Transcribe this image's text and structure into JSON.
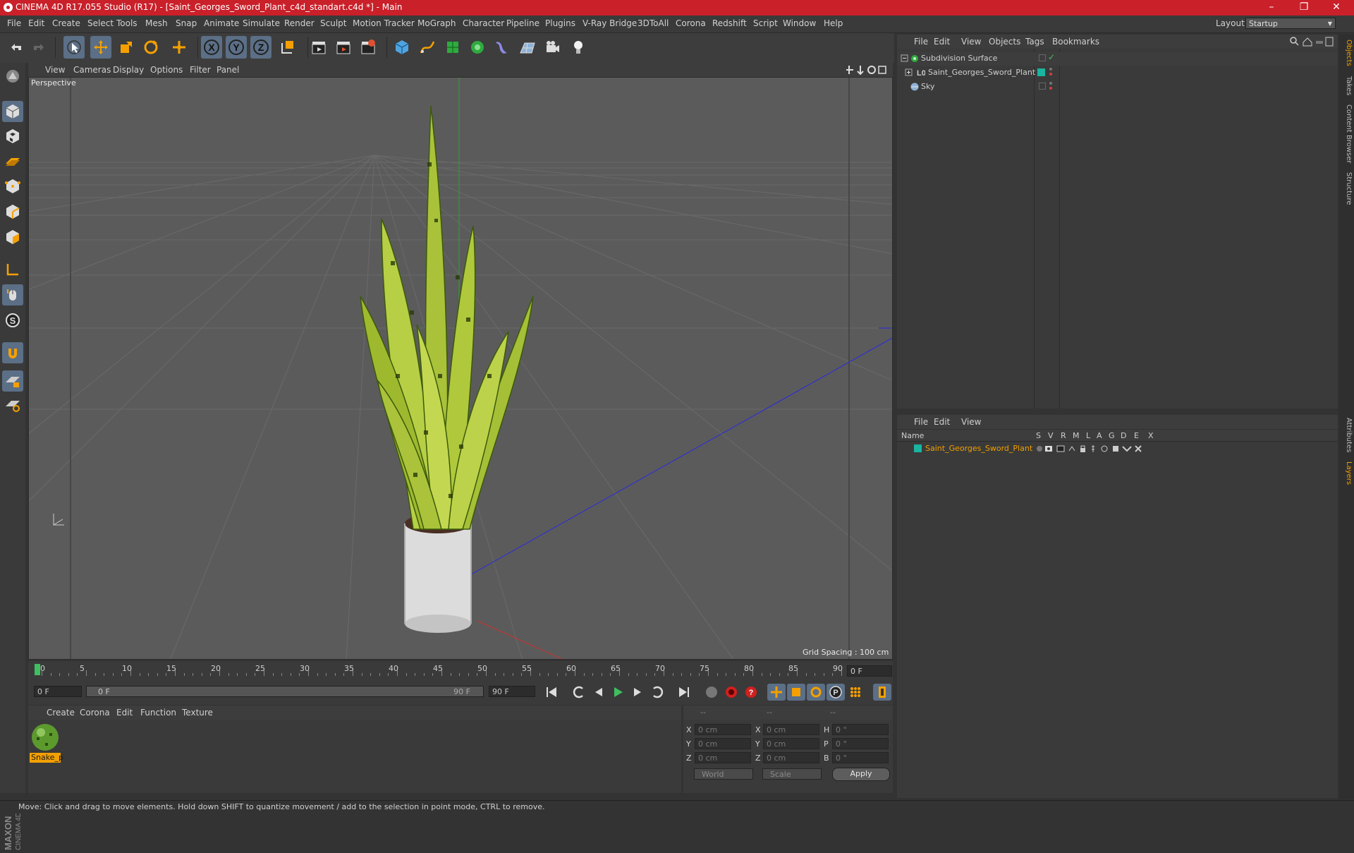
{
  "window": {
    "title": "CINEMA 4D R17.055 Studio (R17) - [Saint_Georges_Sword_Plant_c4d_standart.c4d *] - Main",
    "controls": [
      "–",
      "❐",
      "✕"
    ]
  },
  "menubar": {
    "items": [
      "File",
      "Edit",
      "Create",
      "Select",
      "Tools",
      "Mesh",
      "Snap",
      "Animate",
      "Simulate",
      "Render",
      "Sculpt",
      "Motion Tracker",
      "MoGraph",
      "Character",
      "Pipeline",
      "Plugins",
      "V-Ray Bridge",
      "3DToAll",
      "Corona",
      "Redshift",
      "Script",
      "Window",
      "Help"
    ],
    "layout_label": "Layout:",
    "layout_value": "Startup"
  },
  "viewport": {
    "menu": [
      "View",
      "Cameras",
      "Display",
      "Options",
      "Filter",
      "Panel"
    ],
    "label": "Perspective",
    "grid_spacing": "Grid Spacing : 100 cm"
  },
  "timeline": {
    "ticks": [
      "0",
      "5",
      "10",
      "15",
      "20",
      "25",
      "30",
      "35",
      "40",
      "45",
      "50",
      "55",
      "60",
      "65",
      "70",
      "75",
      "80",
      "85",
      "90"
    ],
    "current_frame": "0 F",
    "start_field": "0 F",
    "range_start": "0 F",
    "range_end": "90 F",
    "end_field": "90 F"
  },
  "materials": {
    "menu": [
      "Create",
      "Corona",
      "Edit",
      "Function",
      "Texture"
    ],
    "items": [
      {
        "name": "Snake_p"
      }
    ]
  },
  "coordinates": {
    "headers": [
      "--",
      "--",
      "--"
    ],
    "rows": [
      {
        "a": "X",
        "av": "0 cm",
        "b": "X",
        "bv": "0 cm",
        "c": "H",
        "cv": "0 °"
      },
      {
        "a": "Y",
        "av": "0 cm",
        "b": "Y",
        "bv": "0 cm",
        "c": "P",
        "cv": "0 °"
      },
      {
        "a": "Z",
        "av": "0 cm",
        "b": "Z",
        "bv": "0 cm",
        "c": "B",
        "cv": "0 °"
      }
    ],
    "mode": "World",
    "transform": "Scale",
    "apply_label": "Apply"
  },
  "objects_panel": {
    "menu": [
      "File",
      "Edit",
      "View",
      "Objects",
      "Tags",
      "Bookmarks"
    ],
    "items": [
      {
        "name": "Subdivision Surface"
      },
      {
        "name": "Saint_Georges_Sword_Plant"
      },
      {
        "name": "Sky"
      }
    ]
  },
  "layers_panel": {
    "menu": [
      "File",
      "Edit",
      "View"
    ],
    "columns": [
      "Name",
      "S",
      "V",
      "R",
      "M",
      "L",
      "A",
      "G",
      "D",
      "E",
      "X"
    ],
    "layers": [
      {
        "name": "Saint_Georges_Sword_Plant",
        "color": "#19b5a0"
      }
    ]
  },
  "side_tabs": [
    "Objects",
    "Takes",
    "Content Browser",
    "Structure",
    "Attributes",
    "Layers"
  ],
  "status_text": "Move: Click and drag to move elements. Hold down SHIFT to quantize movement / add to the selection in point mode, CTRL to remove.",
  "colors": {
    "accent": "#f2a000",
    "title_bar": "#c9202a",
    "layer_color": "#19b5a0",
    "selection": "#5b6f86"
  }
}
